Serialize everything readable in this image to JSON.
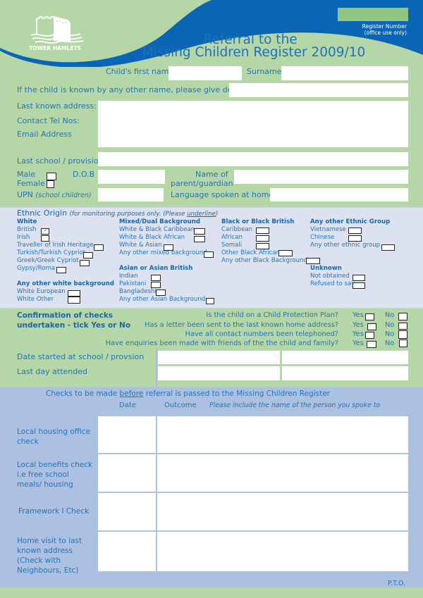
{
  "header": {
    "logo_text": "TOWER HAMLETS",
    "title_line1": "Referral to the",
    "title_line2": "Missing Children Register 2009/10",
    "register_number_label_line1": "Register Number",
    "register_number_label_line2": "(office use only)",
    "register_number_value": ""
  },
  "colors": {
    "green_bg": "#b5d6a7",
    "blue_band": "#0a66b5",
    "text_blue": "#2474b8",
    "ethnic_bg": "#dde2f1",
    "checks_bg": "#acc0e1",
    "register_box": "#92c582"
  },
  "personal": {
    "first_name_label": "Child's first name",
    "first_name_value": "",
    "surname_label": "Surname",
    "surname_value": "",
    "other_name_label": "If the child is known by any other name, please give details",
    "other_name_value": "",
    "address_label": "Last known address:",
    "tel_label": "Contact Tel Nos:",
    "email_label": "Email Address",
    "address_value": "",
    "school_label": "Last school / provision",
    "school_value": "",
    "male_label": "Male",
    "female_label": "Female",
    "male_checked": false,
    "female_checked": false,
    "dob_label": "D.O.B",
    "dob_value": "",
    "parent_label_line1": "Name of",
    "parent_label_line2": "parent/guardian",
    "parent_value": "",
    "upn_label": "UPN",
    "upn_note": "(school children)",
    "upn_value": "",
    "language_label": "Language spoken at home",
    "language_value": ""
  },
  "ethnic": {
    "title": "Ethnic Origin",
    "note_prefix": "(for monitoring purposes only.  (Please ",
    "note_underlined": "underline",
    "note_suffix": ")",
    "groups": {
      "white": {
        "heading": "White",
        "items": [
          "British",
          "Irish",
          "Traveller of Irish Heritage",
          "Turkish/Turkish Cypriot",
          "Greek/Greek Cypriot",
          "Gypsy/Roma"
        ]
      },
      "other_white": {
        "heading": "Any other white background",
        "items": [
          "White European",
          "White Other"
        ]
      },
      "mixed": {
        "heading": "Mixed/Dual Background",
        "items": [
          "White & Black Caribbean",
          "White & Black African",
          "White & Asian",
          "Any other mixed background"
        ]
      },
      "asian": {
        "heading": "Asian or Asian British",
        "items": [
          "Indian",
          "Pakistani",
          "Bangladeshi",
          "Any other Asian Background"
        ]
      },
      "black": {
        "heading": "Black or Black British",
        "items": [
          "Caribbean",
          "African",
          "Somali",
          "Other Black African",
          "Any other Black Background"
        ]
      },
      "other": {
        "heading": "Any other Ethnic Group",
        "items": [
          "Vietnamese",
          "Chinese",
          "Any other ethnic group"
        ]
      },
      "unknown": {
        "heading": "Unknown",
        "items": [
          "Not obtained",
          "Refused to say"
        ]
      }
    },
    "checked": [
      "British"
    ]
  },
  "confirmation": {
    "heading_line1": "Confirmation of checks",
    "heading_line2": "undertaken - tick Yes or No",
    "yes_label": "Yes",
    "no_label": "No",
    "questions": [
      "Is the child on a Child Protection Plan?",
      "Has a letter been sent to the last known home address?",
      "Have all contact numbers  been telephoned?",
      "Have enquiries been made with friends of the the child and family?"
    ],
    "date_started_label": "Date started at school / provsion",
    "last_day_label": "Last day attended"
  },
  "checks": {
    "heading_prefix": "Checks to be made ",
    "heading_underlined": "before",
    "heading_suffix": " referral is passed to the Missing Children Register",
    "col_date": "Date",
    "col_outcome": "Outcome",
    "col_note": "Please include the name of the person you spoke to",
    "rows": [
      {
        "label": "Local housing office check"
      },
      {
        "label": "Local benefits check i.e free school meals/ housing"
      },
      {
        "label": "Framework I Check"
      },
      {
        "label": "Home visit to last known address (Check with Neighbours, Etc)"
      }
    ],
    "pto": "P.T.O."
  }
}
